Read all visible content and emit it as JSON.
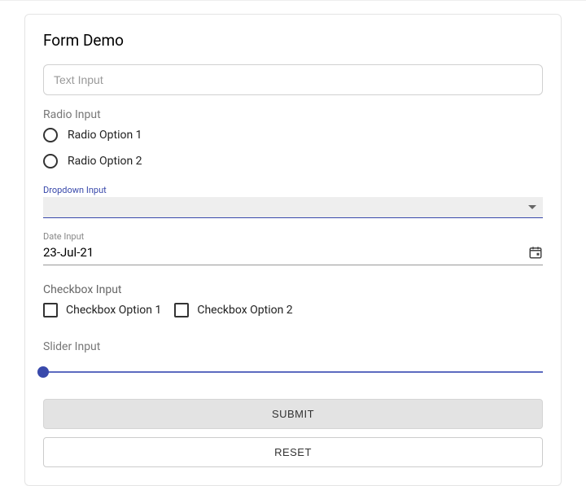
{
  "title": "Form Demo",
  "text_input": {
    "placeholder": "Text Input",
    "value": ""
  },
  "radio": {
    "label": "Radio Input",
    "options": [
      "Radio Option 1",
      "Radio Option 2"
    ]
  },
  "dropdown": {
    "label": "Dropdown Input",
    "value": ""
  },
  "date": {
    "label": "Date Input",
    "value": "23-Jul-21"
  },
  "checkbox": {
    "label": "Checkbox Input",
    "options": [
      "Checkbox Option 1",
      "Checkbox Option 2"
    ]
  },
  "slider": {
    "label": "Slider Input",
    "value": 0
  },
  "buttons": {
    "submit": "SUBMIT",
    "reset": "RESET"
  }
}
